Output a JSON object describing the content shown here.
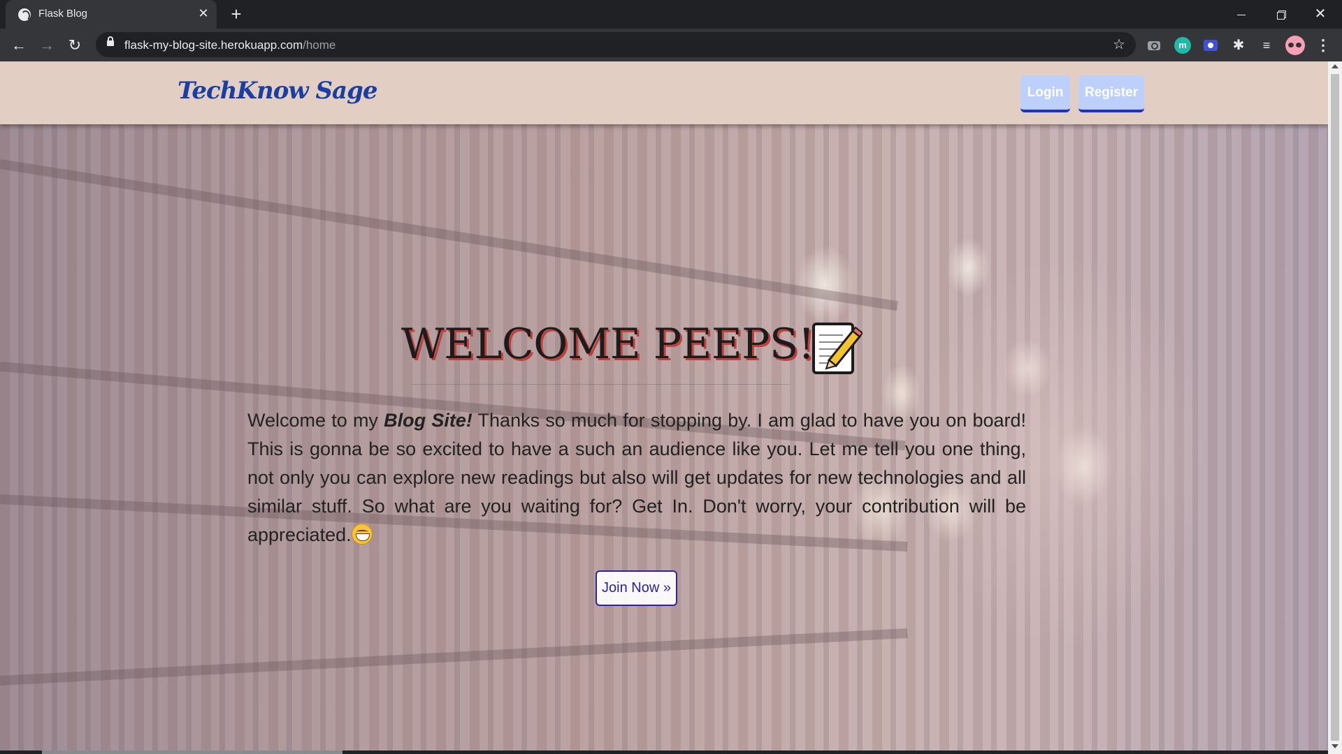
{
  "browser": {
    "tab_title": "Flask Blog",
    "new_tab": "+",
    "url_host": "flask-my-blog-site.herokuapp.com",
    "url_path": "/home"
  },
  "site": {
    "brand": "TechKnow Sage",
    "nav": {
      "login_label": "Login",
      "register_label": "Register"
    }
  },
  "hero": {
    "title": "WELCOME PEEPS!",
    "intro_before": "Welcome to my ",
    "intro_emphasis": "Blog Site!",
    "intro_after": " Thanks so much for stopping by. I am glad to have you on board! This is gonna be so excited to have a such an audience like you. Let me tell you one thing, not only you can explore new readings but also will get updates for new technologies and all similar stuff. So what are you waiting for? Get In. Don't worry, your contribution will be appreciated.",
    "cta_label": "Join Now »"
  },
  "colors": {
    "navbar_bg": "#e3cec4",
    "brand_color": "#1b3fa0",
    "button_bg": "#bcd0fb",
    "button_border": "#1a2fd6",
    "title_shadow": "#c0403e",
    "cta_color": "#2c22a8"
  }
}
